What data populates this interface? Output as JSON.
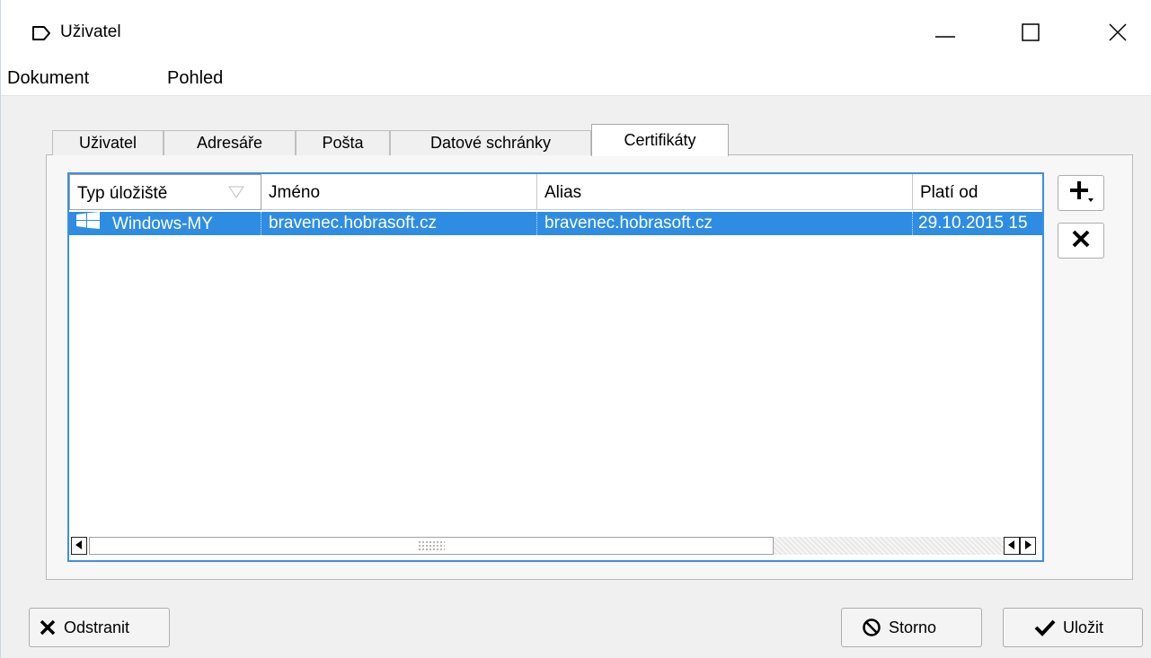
{
  "window": {
    "title": "Uživatel",
    "icon": "window-icon",
    "controls": [
      "minimize-icon",
      "maximize-icon",
      "close-icon"
    ]
  },
  "menu": {
    "items": [
      "Dokument",
      "Pohled"
    ]
  },
  "tabs": [
    {
      "label": "Uživatel",
      "active": false
    },
    {
      "label": "Adresáře",
      "active": false
    },
    {
      "label": "Pošta",
      "active": false
    },
    {
      "label": "Datové schránky",
      "active": false
    },
    {
      "label": "Certifikáty",
      "active": true
    }
  ],
  "table": {
    "columns": [
      "Typ úložiště",
      "Jméno",
      "Alias",
      "Platí od"
    ],
    "rows": [
      {
        "icon": "windows-logo-icon",
        "type": "Windows-MY",
        "name": "bravenec.hobrasoft.cz",
        "alias": "bravenec.hobrasoft.cz",
        "valid_from": "29.10.2015 15",
        "selected": true
      }
    ]
  },
  "side_buttons": [
    "add-icon",
    "remove-icon"
  ],
  "footer": {
    "remove_label": "Odstranit",
    "cancel_label": "Storno",
    "save_label": "Uložit"
  },
  "colors": {
    "selection": "#2e8de3",
    "focus_border": "#3d8fe0"
  }
}
